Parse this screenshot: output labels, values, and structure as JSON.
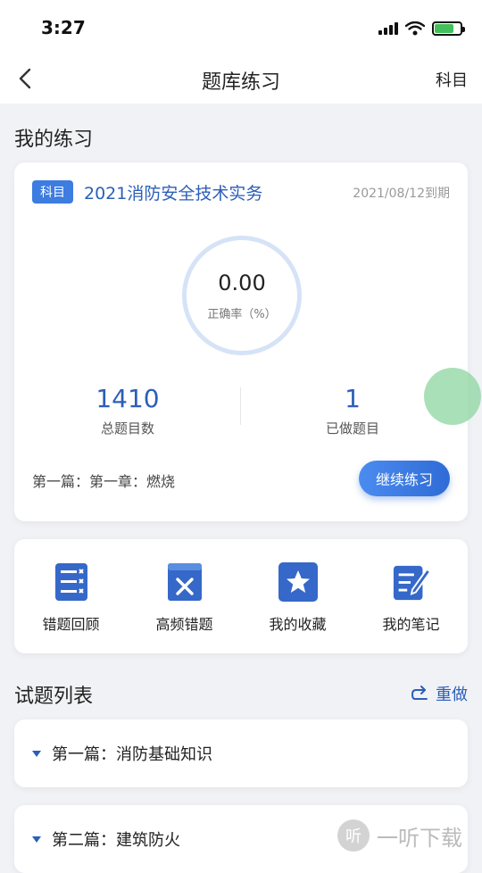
{
  "status_bar": {
    "time": "3:27"
  },
  "nav": {
    "title": "题库练习",
    "right_label": "科目"
  },
  "my_practice": {
    "section_title": "我的练习",
    "subject_tag": "科目",
    "subject_name": "2021消防安全技术实务",
    "expire": "2021/08/12到期",
    "accuracy_value": "0.00",
    "accuracy_label": "正确率（%）",
    "total_value": "1410",
    "total_label": "总题目数",
    "done_value": "1",
    "done_label": "已做题目",
    "progress": "第一篇：第一章：燃烧",
    "continue_label": "继续练习"
  },
  "tools": [
    {
      "label": "错题回顾",
      "icon": "list-check-icon"
    },
    {
      "label": "高频错题",
      "icon": "book-x-icon"
    },
    {
      "label": "我的收藏",
      "icon": "star-icon"
    },
    {
      "label": "我的笔记",
      "icon": "note-edit-icon"
    }
  ],
  "question_list": {
    "section_title": "试题列表",
    "redo_label": "重做",
    "chapters": [
      {
        "name": "第一篇：消防基础知识"
      },
      {
        "name": "第二篇：建筑防火"
      }
    ]
  },
  "watermark": {
    "text": "一听下载",
    "logo": "听"
  },
  "colors": {
    "accent": "#2b5fb8",
    "button": "#3a78e0",
    "float_ball": "#8ed6a0"
  }
}
